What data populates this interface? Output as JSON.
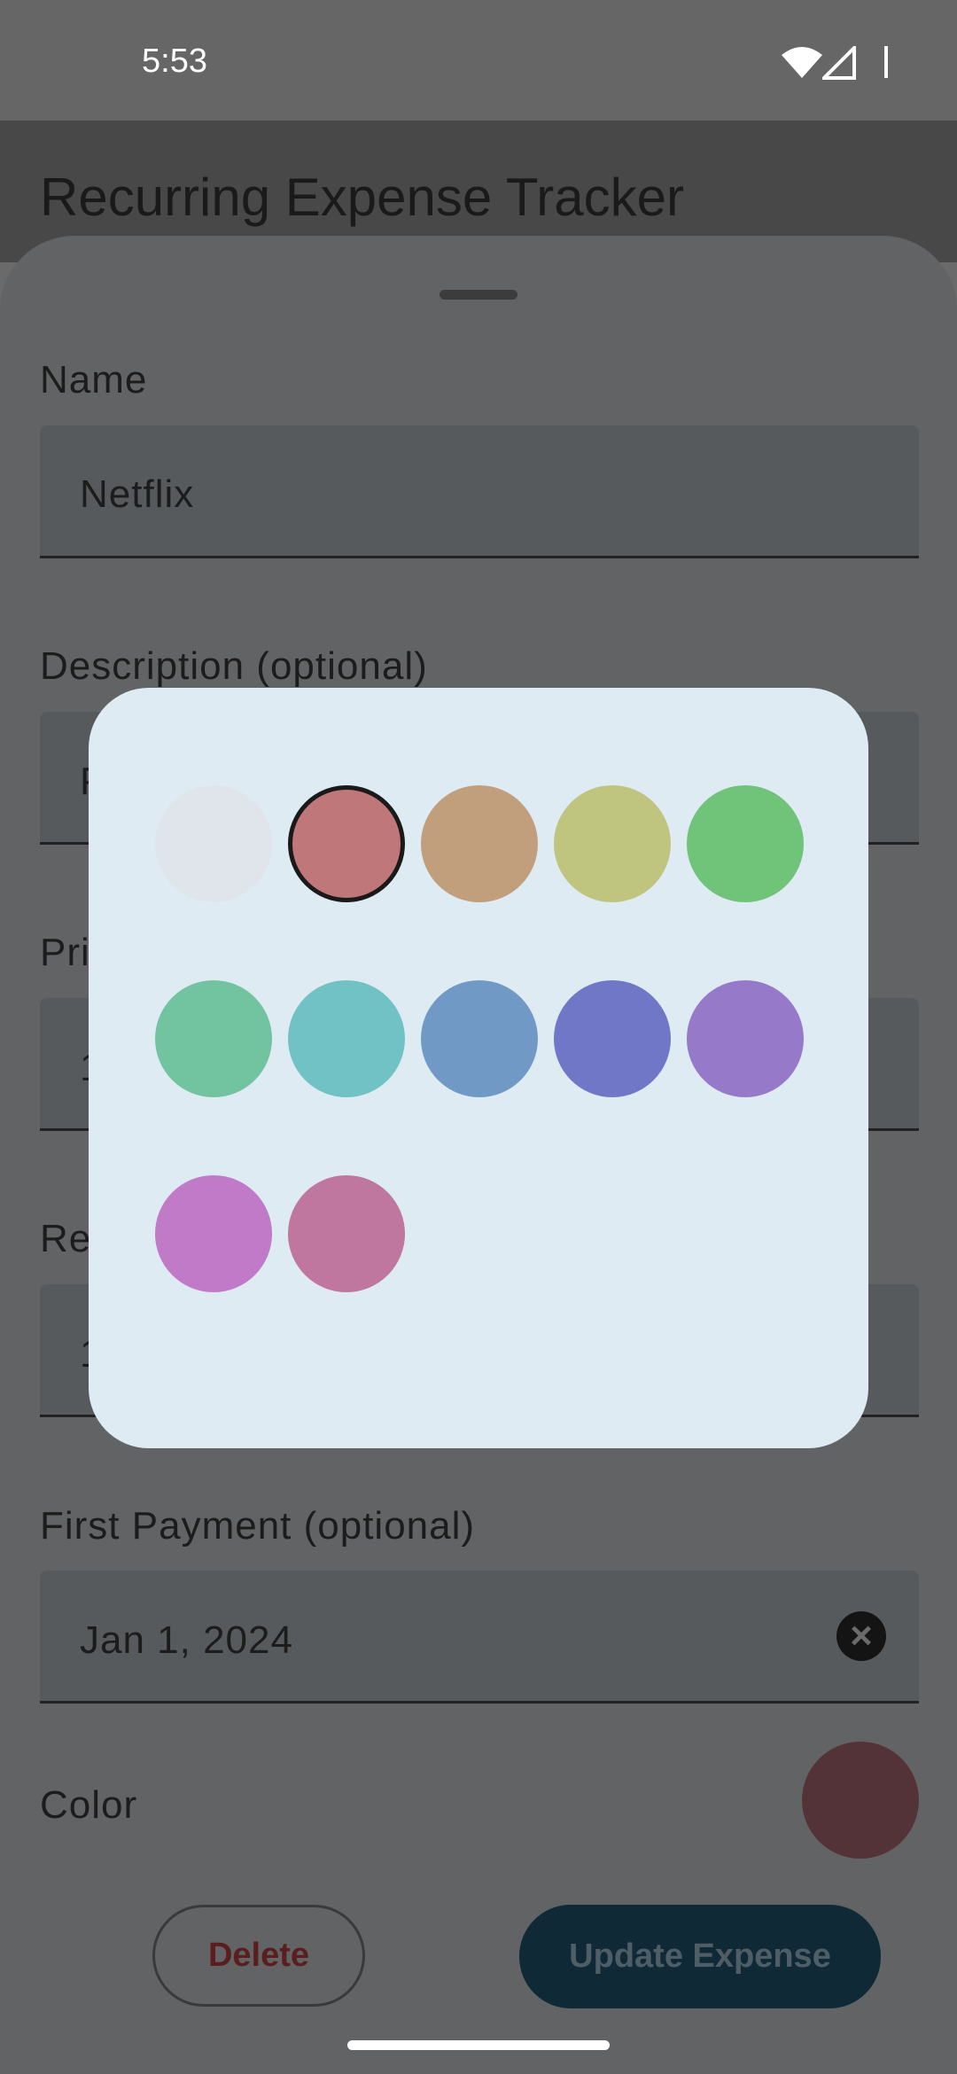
{
  "status_bar": {
    "time": "5:53"
  },
  "app_bar": {
    "title": "Recurring Expense Tracker"
  },
  "form": {
    "name_label": "Name",
    "name_value": "Netflix",
    "description_label": "Description (optional)",
    "description_value_partial": "P",
    "price_label_partial": "Pri",
    "price_value_partial": "1",
    "recurrence_label_partial": "Re",
    "recurrence_value_partial": "1",
    "first_payment_label": "First Payment (optional)",
    "first_payment_value": "Jan 1, 2024",
    "clear_icon": "close-circle-icon",
    "color_label": "Color",
    "current_color": "#533337"
  },
  "actions": {
    "delete_label": "Delete",
    "update_label": "Update Expense"
  },
  "color_picker": {
    "selected_index": 1,
    "colors": [
      "#dfe5eb",
      "#bf7779",
      "#c19f7d",
      "#bfc47e",
      "#70c47a",
      "#71c49f",
      "#71c2c5",
      "#709ac5",
      "#7177c7",
      "#9679c8",
      "#c07ac8",
      "#bf779f"
    ]
  }
}
